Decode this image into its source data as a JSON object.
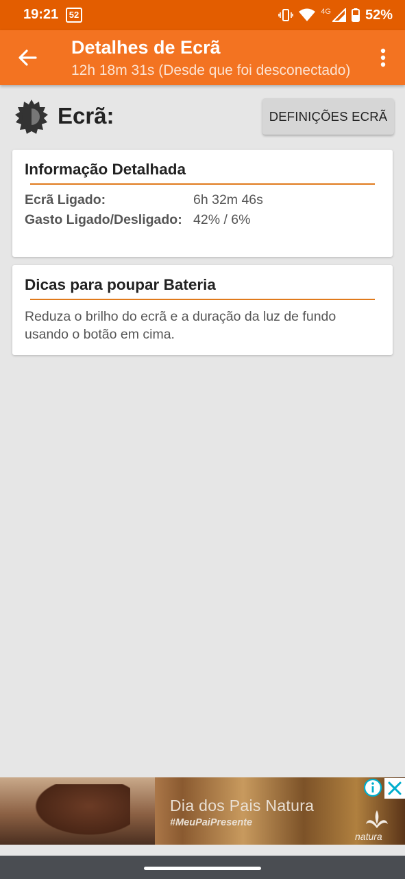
{
  "status_bar": {
    "time": "19:21",
    "badge": "52",
    "network": "4G",
    "battery_percent": "52%",
    "icons": [
      "vibrate-icon",
      "wifi-icon",
      "signal-icon",
      "battery-icon"
    ]
  },
  "app_bar": {
    "title": "Detalhes de Ecrã",
    "subtitle": "12h 18m 31s (Desde que foi desconectado)",
    "back_icon": "arrow-back-icon",
    "menu_icon": "more-vert-icon",
    "color": "#f37321"
  },
  "header": {
    "section_title": "Ecrã:",
    "settings_button": "DEFINIÇÕES ECRÃ",
    "icon": "brightness-icon"
  },
  "detail_card": {
    "title": "Informação Detalhada",
    "rows": [
      {
        "label": "Ecrã Ligado:",
        "value": "6h 32m 46s"
      },
      {
        "label": "Gasto Ligado/Desligado:",
        "value": "42% / 6%"
      }
    ]
  },
  "tips_card": {
    "title": "Dicas para poupar Bateria",
    "text": "Reduza o brilho do ecrã e a duração da luz de fundo usando o botão em cima."
  },
  "ad": {
    "headline": "Dia dos Pais Natura",
    "hashtag": "#MeuPaiPresente",
    "brand": "natura"
  },
  "colors": {
    "status_bar": "#e35d00",
    "accent": "#f37321",
    "divider": "#e07a1c",
    "background": "#e6e6e6"
  }
}
